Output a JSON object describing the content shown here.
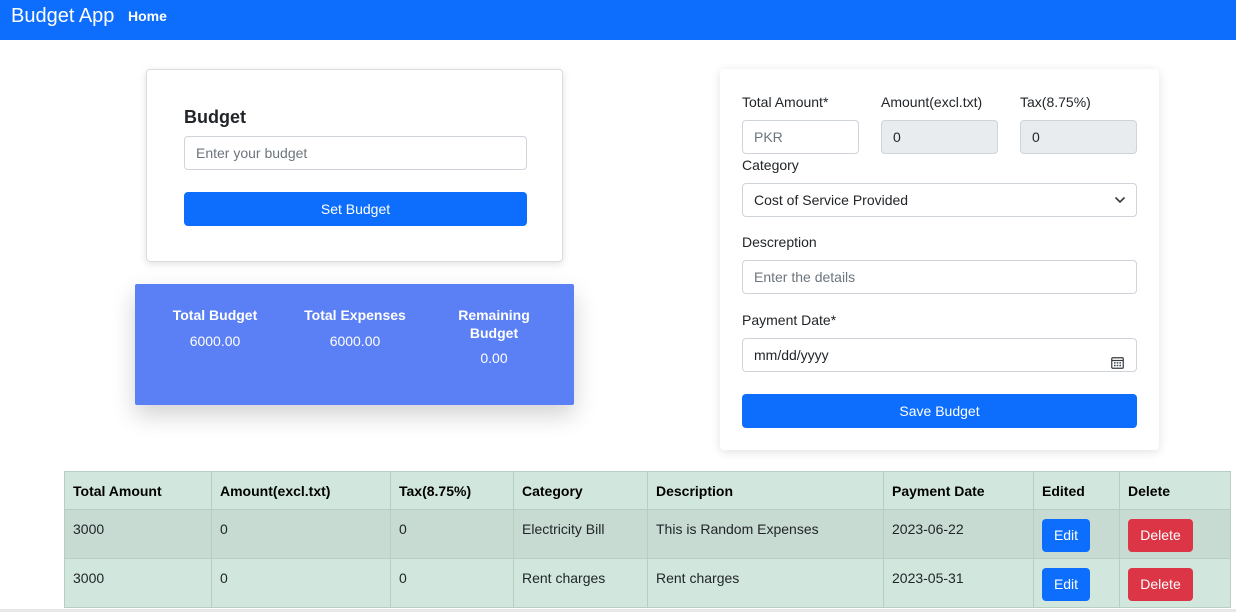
{
  "navbar": {
    "brand": "Budget App",
    "home": "Home"
  },
  "budget_card": {
    "title": "Budget",
    "input_placeholder": "Enter your budget",
    "button_label": "Set Budget"
  },
  "summary": {
    "total_budget_label": "Total Budget",
    "total_budget_value": "6000.00",
    "total_expenses_label": "Total Expenses",
    "total_expenses_value": "6000.00",
    "remaining_label_line1": "Remaining",
    "remaining_label_line2": "Budget",
    "remaining_value": "0.00"
  },
  "expense_form": {
    "total_amount_label": "Total Amount*",
    "total_amount_placeholder": "PKR",
    "amount_excl_label": "Amount(excl.txt)",
    "amount_excl_value": "0",
    "tax_label": "Tax(8.75%)",
    "tax_value": "0",
    "category_label": "Category",
    "category_selected": "Cost of Service Provided",
    "description_label": "Descreption",
    "description_placeholder": "Enter the details",
    "payment_date_label": "Payment Date*",
    "payment_date_placeholder": "mm/dd/yyyy",
    "save_button": "Save Budget"
  },
  "table": {
    "headers": [
      "Total Amount",
      "Amount(excl.txt)",
      "Tax(8.75%)",
      "Category",
      "Description",
      "Payment Date",
      "Edited",
      "Delete"
    ],
    "rows": [
      {
        "total": "3000",
        "excl": "0",
        "tax": "0",
        "category": "Electricity Bill",
        "description": "This is Random Expenses",
        "date": "2023-06-22",
        "edit": "Edit",
        "delete": "Delete"
      },
      {
        "total": "3000",
        "excl": "0",
        "tax": "0",
        "category": "Rent charges",
        "description": "Rent charges",
        "date": "2023-05-31",
        "edit": "Edit",
        "delete": "Delete"
      }
    ]
  },
  "colors": {
    "primary": "#0d6efd",
    "summary_bg": "#5b7ff5",
    "danger": "#dc3545",
    "table_bg": "#d1e7dd"
  },
  "icons": {
    "category_dropdown": "chevron-down-icon",
    "date_picker": "calendar-icon"
  }
}
